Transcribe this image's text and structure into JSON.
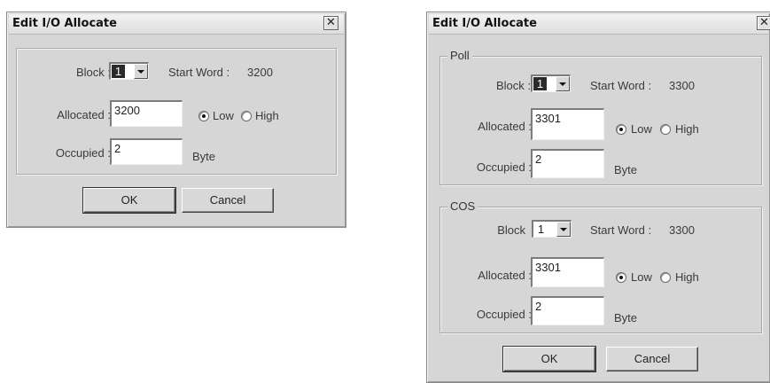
{
  "dialog1": {
    "title": "Edit I/O Allocate",
    "close_glyph": "✕",
    "block_label": "Block :",
    "block_value": "1",
    "start_word_label": "Start Word :",
    "start_word_value": "3200",
    "allocated_label": "Allocated :",
    "allocated_value": "3200",
    "low_label": "Low",
    "high_label": "High",
    "occupied_label": "Occupied :",
    "occupied_value": "2",
    "unit_label": "Byte",
    "ok_label": "OK",
    "cancel_label": "Cancel"
  },
  "dialog2": {
    "title": "Edit I/O Allocate",
    "close_glyph": "✕",
    "poll": {
      "legend": "Poll",
      "block_label": "Block :",
      "block_value": "1",
      "start_word_label": "Start Word :",
      "start_word_value": "3300",
      "allocated_label": "Allocated :",
      "allocated_value": "3301",
      "low_label": "Low",
      "high_label": "High",
      "occupied_label": "Occupied :",
      "occupied_value": "2",
      "unit_label": "Byte"
    },
    "cos": {
      "legend": "COS",
      "block_label": "Block",
      "block_value": "1",
      "start_word_label": "Start Word :",
      "start_word_value": "3300",
      "allocated_label": "Allocated :",
      "allocated_value": "3301",
      "low_label": "Low",
      "high_label": "High",
      "occupied_label": "Occupied :",
      "occupied_value": "2",
      "unit_label": "Byte"
    },
    "ok_label": "OK",
    "cancel_label": "Cancel"
  }
}
